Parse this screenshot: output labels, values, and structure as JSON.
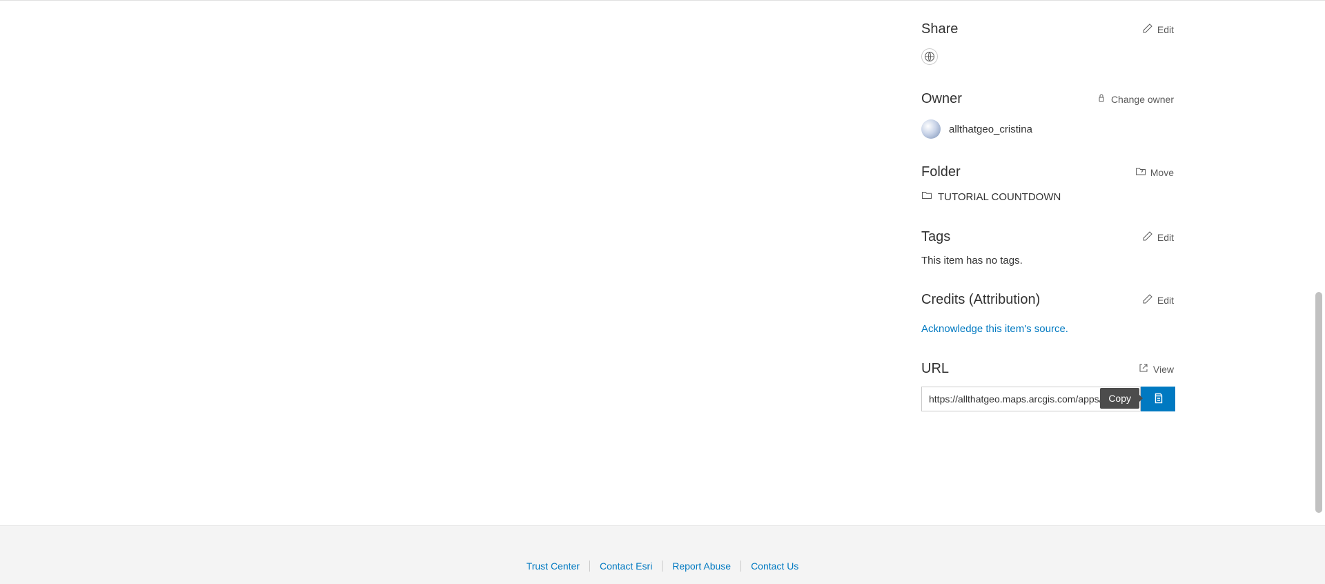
{
  "sections": {
    "share": {
      "title": "Share",
      "edit_label": "Edit"
    },
    "owner": {
      "title": "Owner",
      "change_label": "Change owner",
      "name": "allthatgeo_cristina"
    },
    "folder": {
      "title": "Folder",
      "move_label": "Move",
      "name": "TUTORIAL COUNTDOWN"
    },
    "tags": {
      "title": "Tags",
      "edit_label": "Edit",
      "empty_text": "This item has no tags."
    },
    "credits": {
      "title": "Credits (Attribution)",
      "edit_label": "Edit",
      "link_text": "Acknowledge this item's source."
    },
    "url": {
      "title": "URL",
      "view_label": "View",
      "value": "https://allthatgeo.maps.arcgis.com/apps/instant/countdown/index.html",
      "copy_tooltip": "Copy"
    }
  },
  "footer": {
    "links": [
      "Trust Center",
      "Contact Esri",
      "Report Abuse",
      "Contact Us"
    ]
  }
}
